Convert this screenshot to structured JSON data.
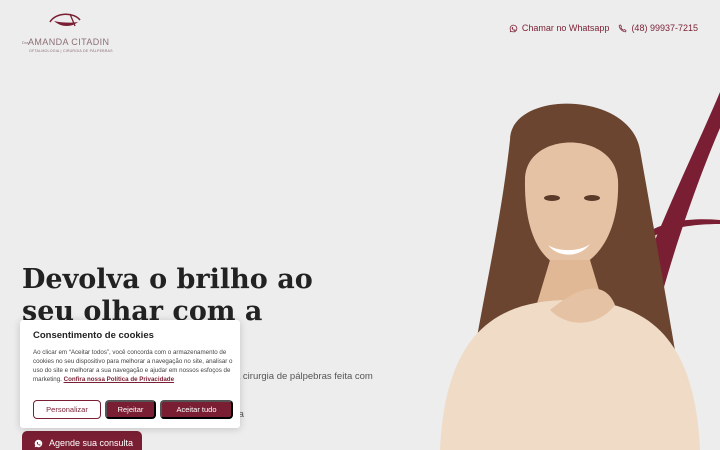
{
  "header": {
    "logo": {
      "prefix": "Dra.",
      "name": "AMANDA CITADIN",
      "subtitle": "OFTALMOLOGIA | CIRURGIA DE PÁLPEBRAS"
    },
    "whatsapp_label": "Chamar no Whatsapp",
    "phone_label": "(48) 99937-7215"
  },
  "hero": {
    "title": "Devolva o brilho ao seu olhar com a cirurgia de",
    "text_partial": "a cirurgia de pálpebras feita com",
    "text_partial2": "ta",
    "cta_label": "Agende sua consulta"
  },
  "cookie_banner": {
    "title": "Consentimento de cookies",
    "body": "Ao clicar em “Aceitar todos”, você concorda com o armazenamento de cookies no seu dispositivo para melhorar a navegação no site, analisar o uso do site e melhorar a sua navegação e ajudar em nossos esfoços de marketing.",
    "policy_link": "Confira nossa Política de Privacidade",
    "customize_label": "Personalizar",
    "reject_label": "Rejeitar",
    "accept_label": "Aceitar tudo"
  },
  "colors": {
    "brand": "#7a1f33",
    "background": "#ededee"
  },
  "icons": {
    "whatsapp": "whatsapp-icon",
    "phone": "phone-icon"
  }
}
